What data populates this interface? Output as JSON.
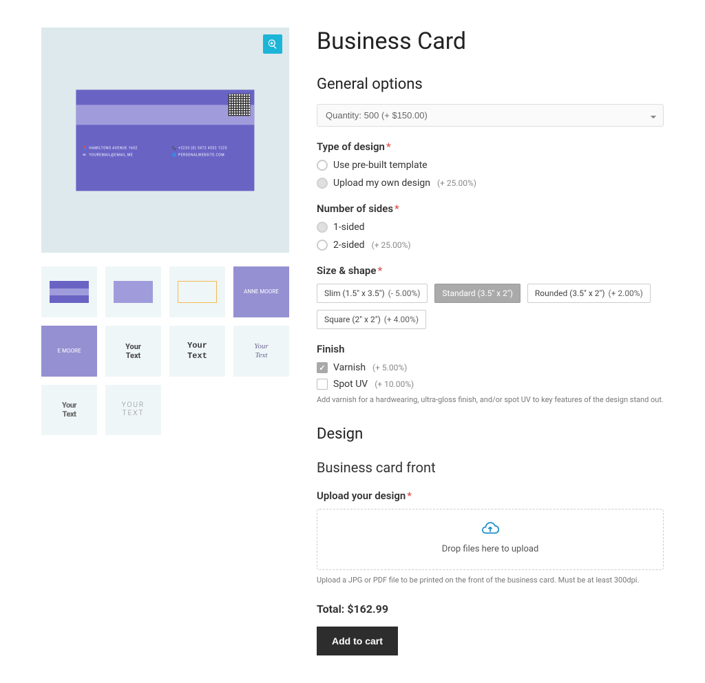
{
  "product": {
    "title": "Business Card"
  },
  "card_preview": {
    "address": "HAMILTONS AVENUE 1602",
    "email": "YOUREMAIL@EMAIL.ME",
    "phone": "+2233 (0) 3472 4552 1225",
    "website": "PERSONALWEBSITE.COM"
  },
  "thumbnails": [
    {
      "type": "minicard"
    },
    {
      "type": "stripe"
    },
    {
      "type": "outline"
    },
    {
      "type": "purple",
      "text": "ANNE MOORE"
    },
    {
      "type": "purple",
      "text": "E MOORE"
    },
    {
      "type": "bold",
      "text": "Your\nText"
    },
    {
      "type": "tech",
      "text": "Your\nText"
    },
    {
      "type": "script",
      "text": "Your\nText"
    },
    {
      "type": "block",
      "text": "Your\nText"
    },
    {
      "type": "thin",
      "text": "YOUR\nTEXT"
    }
  ],
  "sections": {
    "general": "General options",
    "design": "Design",
    "front": "Business card front"
  },
  "quantity": {
    "selected_label": "Quantity: 500 (+ $150.00)"
  },
  "fields": {
    "type_of_design": {
      "label": "Type of design",
      "options": [
        {
          "label": "Use pre-built template",
          "adj": ""
        },
        {
          "label": "Upload my own design",
          "adj": "(+ 25.00%)"
        }
      ]
    },
    "sides": {
      "label": "Number of sides",
      "options": [
        {
          "label": "1-sided",
          "adj": ""
        },
        {
          "label": "2-sided",
          "adj": "(+ 25.00%)"
        }
      ]
    },
    "size": {
      "label": "Size & shape",
      "options": [
        {
          "label": "Slim (1.5\" x 3.5\")",
          "adj": "(- 5.00%)"
        },
        {
          "label": "Standard (3.5\" x 2\")",
          "adj": ""
        },
        {
          "label": "Rounded (3.5\" x 2\")",
          "adj": "(+ 2.00%)"
        },
        {
          "label": "Square (2\" x 2\")",
          "adj": "(+ 4.00%)"
        }
      ]
    },
    "finish": {
      "label": "Finish",
      "options": [
        {
          "label": "Varnish",
          "adj": "(+ 5.00%)"
        },
        {
          "label": "Spot UV",
          "adj": "(+ 10.00%)"
        }
      ],
      "help": "Add varnish for a hardwearing, ultra-gloss finish, and/or spot UV to key features of the design stand out."
    },
    "upload": {
      "label": "Upload your design",
      "drop_text": "Drop files here to upload",
      "help": "Upload a JPG or PDF file to be printed on the front of the business card. Must be at least 300dpi."
    }
  },
  "total": {
    "label": "Total:",
    "value": "$162.99"
  },
  "buttons": {
    "add_to_cart": "Add to cart"
  }
}
